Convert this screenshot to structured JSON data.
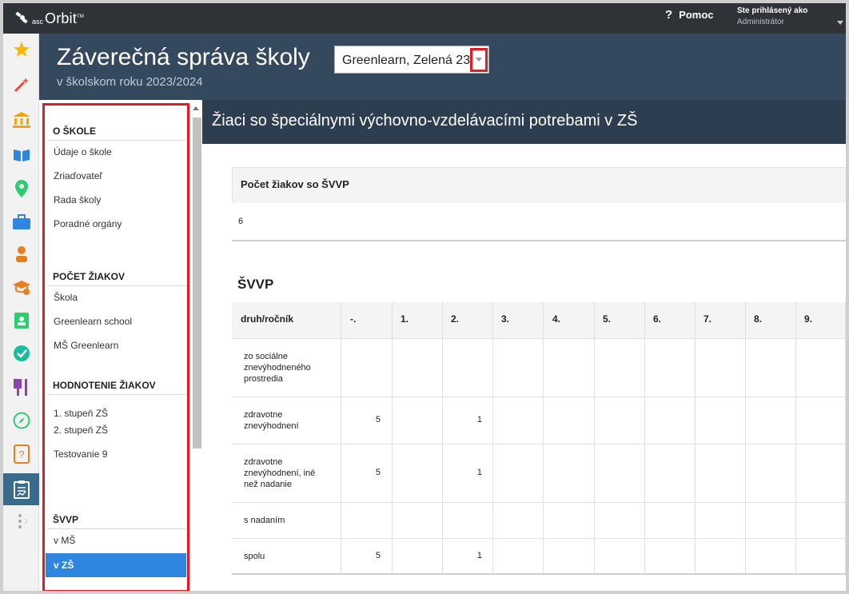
{
  "topbar": {
    "logo_prefix": "asc",
    "logo_name": "Orbit",
    "logo_tm": "TM",
    "help_icon": "?",
    "help_label": "Pomoc",
    "user_line1": "Ste prihlásený ako",
    "user_line2": "Administrátor"
  },
  "iconbar": {
    "icons": [
      "star-icon",
      "magic-wand-icon",
      "institution-icon",
      "book-icon",
      "map-pin-icon",
      "briefcase-icon",
      "person-icon",
      "graduation-cap-icon",
      "clipboard-person-icon",
      "check-circle-icon",
      "dining-icon",
      "compass-icon",
      "question-book-icon",
      "report-icon",
      "more-icon"
    ]
  },
  "header": {
    "title": "Záverečná správa školy",
    "subtitle": "v školskom roku 2023/2024",
    "school_select_value": "Greenlearn, Zelená 23"
  },
  "nav": {
    "sections": [
      {
        "title": "O ŠKOLE",
        "items": [
          "Údaje o škole",
          "Zriaďovateľ",
          "Rada školy",
          "Poradné orgány"
        ]
      },
      {
        "title": "POČET ŽIAKOV",
        "items": [
          "Škola",
          "Greenlearn school",
          "MŠ Greenlearn"
        ]
      },
      {
        "title": "HODNOTENIE ŽIAKOV",
        "items": [
          "1. stupeň ZŠ",
          "2. stupeň ZŠ",
          "Testovanie 9"
        ]
      },
      {
        "title": "ŠVVP",
        "items": [
          "v MŠ",
          "v ZŠ"
        ]
      }
    ],
    "active_item": "v ZŠ"
  },
  "main": {
    "title": "Žiaci so špeciálnymi výchovno-vzdelávacími potrebami v ZŠ",
    "count_label": "Počet žiakov so ŠVVP",
    "count_value": "6",
    "svvp_title": "ŠVVP",
    "table": {
      "headers": [
        "druh/ročník",
        "-.",
        "1.",
        "2.",
        "3.",
        "4.",
        "5.",
        "6.",
        "7.",
        "8.",
        "9."
      ],
      "rows": [
        {
          "label": "zo sociálne znevýhodneného prostredia",
          "values": [
            "",
            "",
            "",
            "",
            "",
            "",
            "",
            "",
            "",
            ""
          ]
        },
        {
          "label": "zdravotne znevýhodnení",
          "values": [
            "5",
            "",
            "1",
            "",
            "",
            "",
            "",
            "",
            "",
            ""
          ]
        },
        {
          "label": "zdravotne znevýhodnení, iné než nadanie",
          "values": [
            "5",
            "",
            "1",
            "",
            "",
            "",
            "",
            "",
            "",
            ""
          ]
        },
        {
          "label": "s nadaním",
          "values": [
            "",
            "",
            "",
            "",
            "",
            "",
            "",
            "",
            "",
            ""
          ]
        },
        {
          "label": "spolu",
          "values": [
            "5",
            "",
            "1",
            "",
            "",
            "",
            "",
            "",
            "",
            ""
          ]
        }
      ]
    }
  },
  "colors": {
    "topbar": "#2f3338",
    "header": "#34495e",
    "main_header": "#2d3e50",
    "active_nav": "#2e86de",
    "highlight_red": "#e21a22"
  }
}
